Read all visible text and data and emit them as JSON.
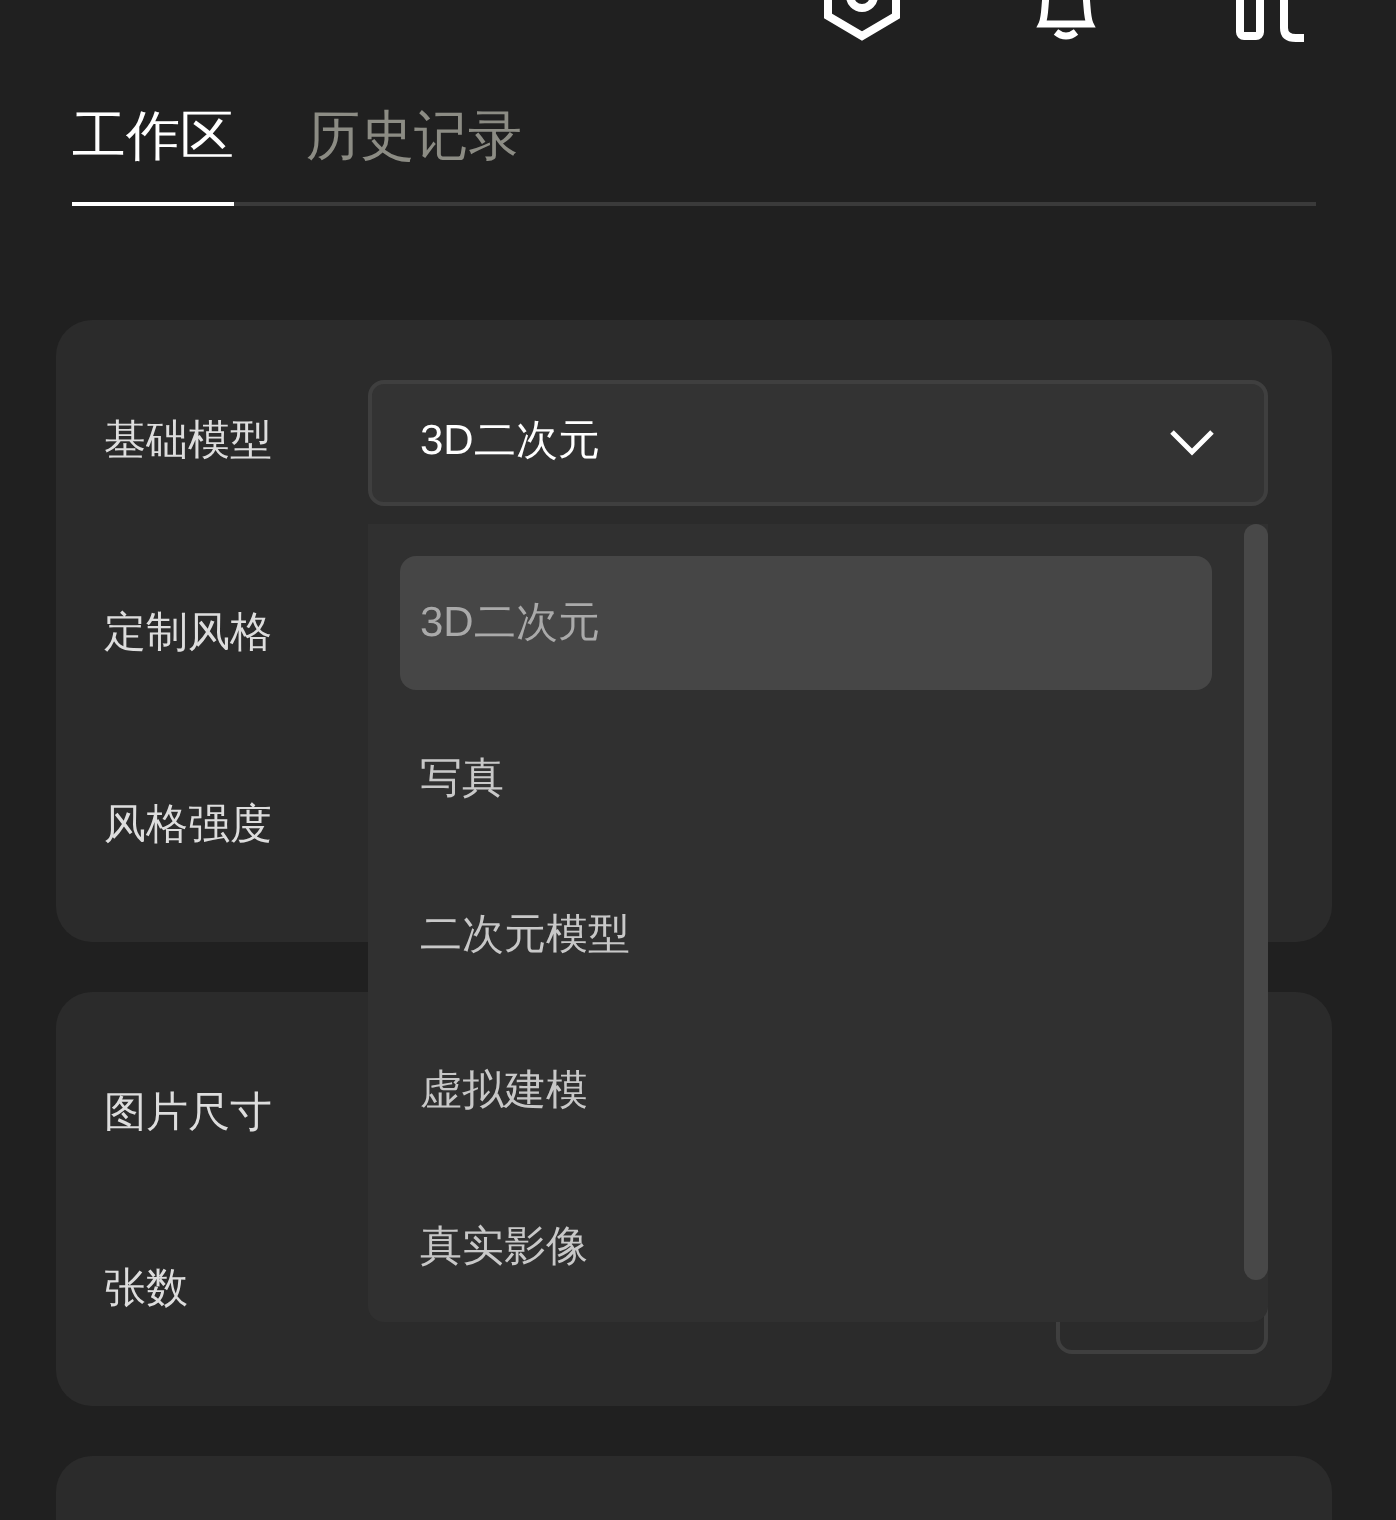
{
  "tabs": [
    {
      "label": "工作区",
      "selected": true
    },
    {
      "label": "历史记录",
      "selected": false
    }
  ],
  "cards": [
    {
      "fields": [
        {
          "label": "基础模型",
          "kind": "select",
          "value": "3D二次元"
        },
        {
          "label": "定制风格",
          "kind": "blank"
        },
        {
          "label": "风格强度",
          "kind": "blank"
        }
      ]
    },
    {
      "fields": [
        {
          "label": "图片尺寸",
          "kind": "blank"
        },
        {
          "label": "张数",
          "kind": "input"
        }
      ]
    },
    {
      "kind": "partial"
    }
  ],
  "dropdown": {
    "options": [
      {
        "label": "3D二次元",
        "selected": true
      },
      {
        "label": "写真",
        "selected": false
      },
      {
        "label": "二次元模型",
        "selected": false
      },
      {
        "label": "虚拟建模",
        "selected": false
      },
      {
        "label": "真实影像",
        "selected": false
      }
    ]
  }
}
